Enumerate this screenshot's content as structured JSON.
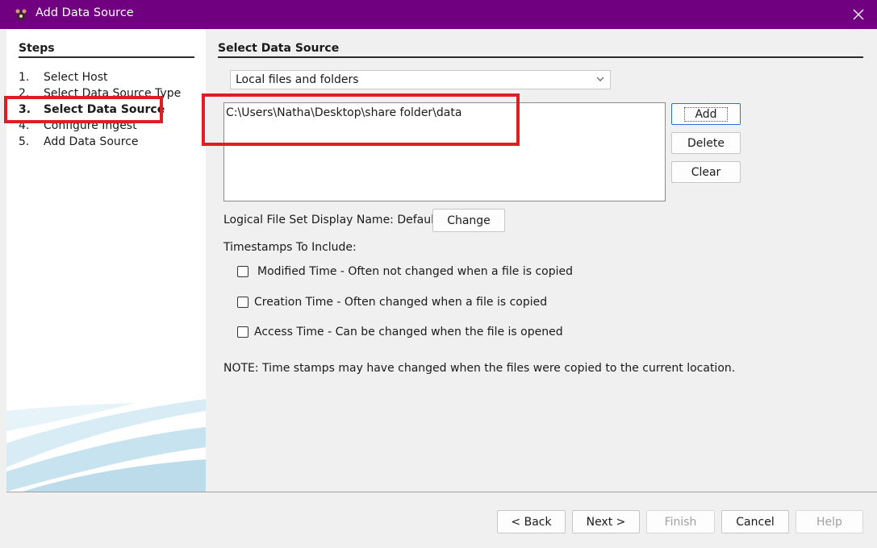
{
  "window": {
    "title": "Add Data Source",
    "title_bar_color": "#700080",
    "close_symbol": "✕"
  },
  "steps": {
    "header": "Steps",
    "items": [
      {
        "num": "1.",
        "label": "Select Host"
      },
      {
        "num": "2.",
        "label": "Select Data Source Type"
      },
      {
        "num": "3.",
        "label": "Select Data Source"
      },
      {
        "num": "4.",
        "label": "Configure Ingest"
      },
      {
        "num": "5.",
        "label": "Add Data Source"
      }
    ],
    "active_index": 2
  },
  "main": {
    "header": "Select Data Source",
    "source_type": {
      "selected": "Local files and folders"
    },
    "paths": [
      "C:\\Users\\Natha\\Desktop\\share folder\\data"
    ],
    "buttons": {
      "add": "Add",
      "delete": "Delete",
      "clear": "Clear"
    },
    "display_name": {
      "label": "Logical File Set Display Name: Default",
      "change": "Change"
    },
    "timestamps": {
      "label": "Timestamps To Include:",
      "modified": {
        "label": "Modified Time - Often not changed when a file is copied",
        "checked": false
      },
      "creation": {
        "label": "Creation Time - Often changed when a file is copied",
        "checked": false
      },
      "access": {
        "label": "Access Time - Can be changed when the file is opened",
        "checked": false
      }
    },
    "note": "NOTE: Time stamps may have changed when the files were copied to the current location."
  },
  "footer": {
    "back": "< Back",
    "next": "Next >",
    "finish": "Finish",
    "cancel": "Cancel",
    "help": "Help"
  },
  "highlight_color": "#e11c22"
}
